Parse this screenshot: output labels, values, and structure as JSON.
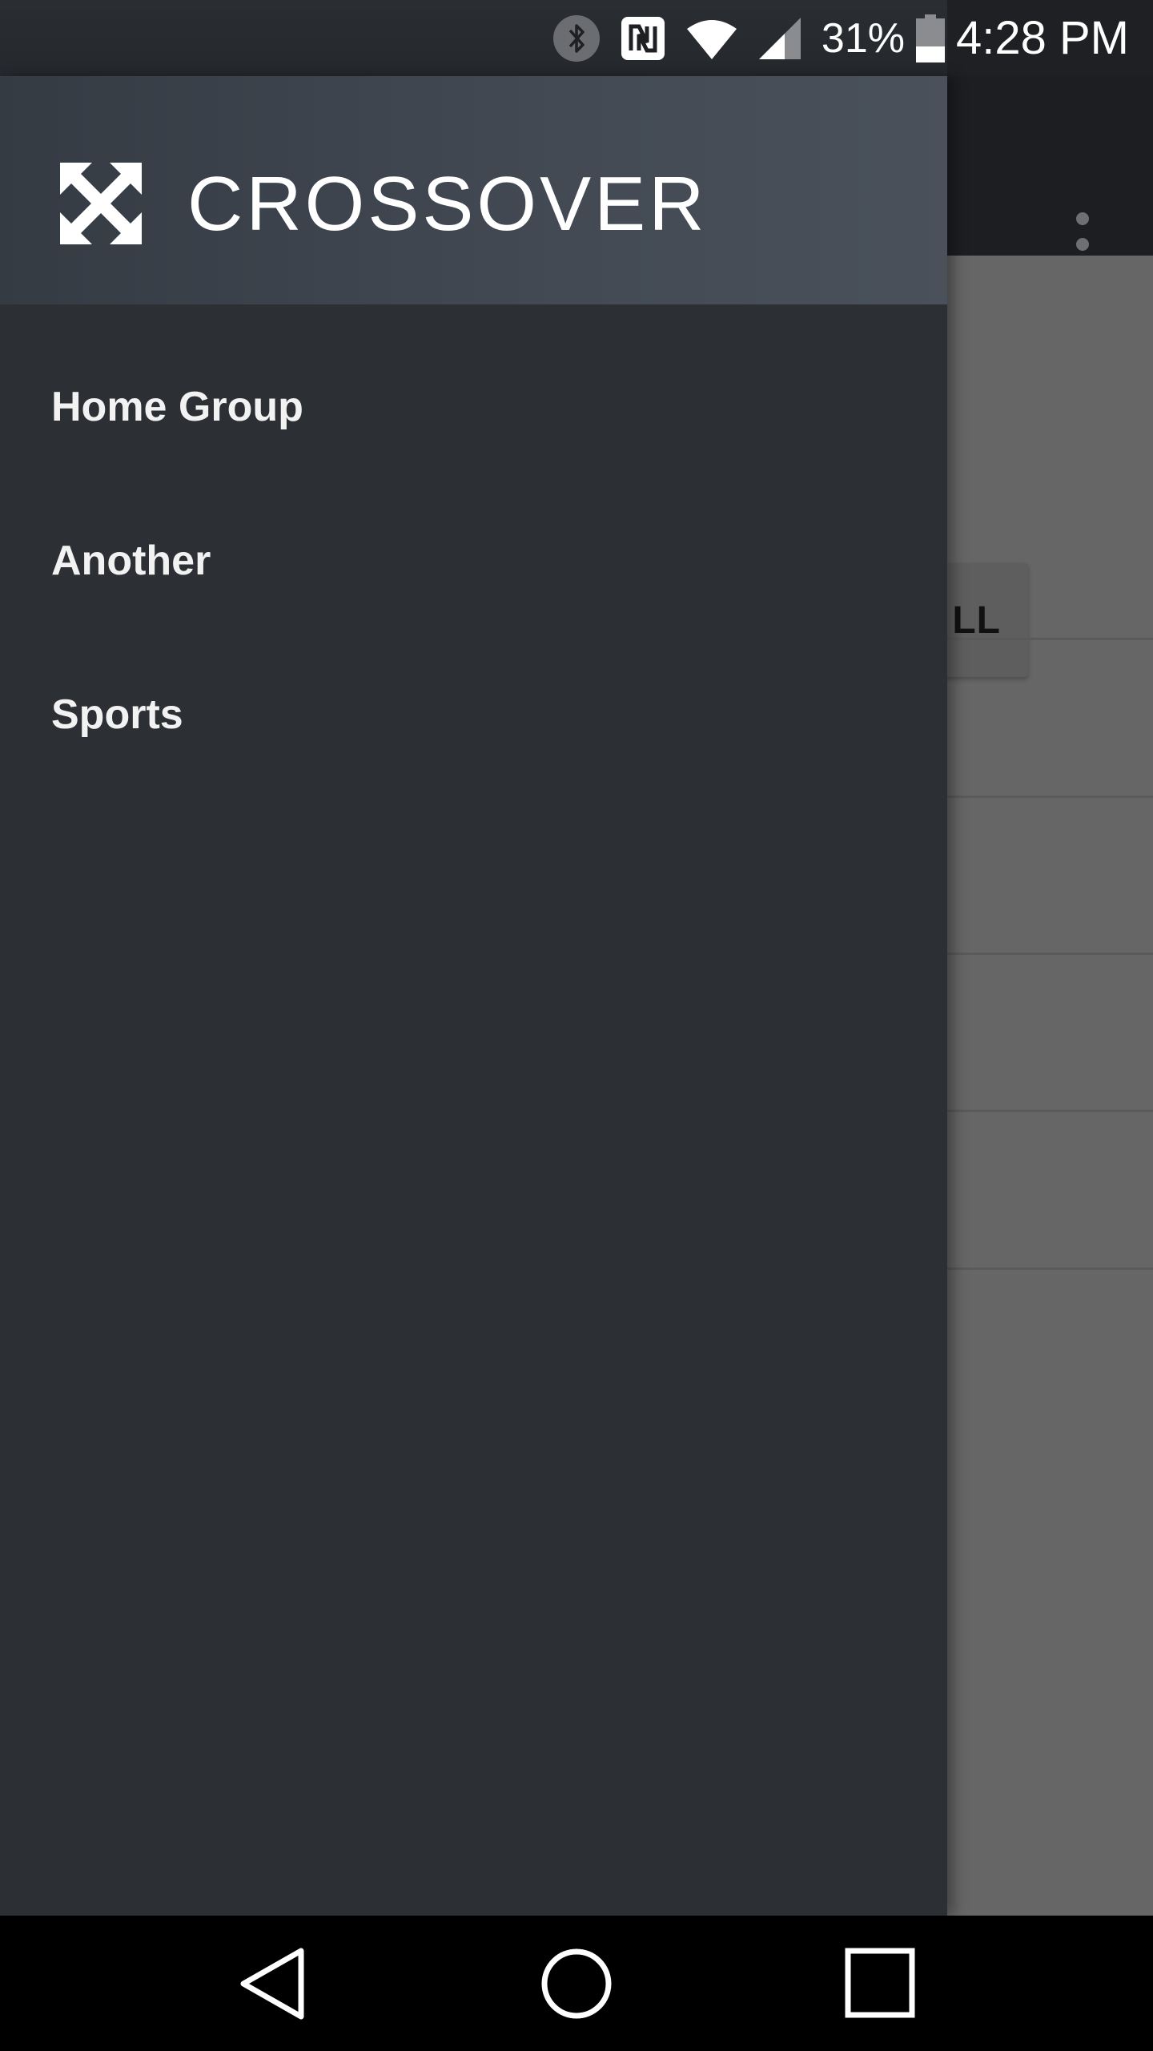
{
  "status_bar": {
    "battery_percent": "31%",
    "time": "4:28 PM",
    "icons": [
      "bluetooth-icon",
      "nfc-icon",
      "wifi-icon",
      "cell-signal-icon",
      "battery-icon"
    ]
  },
  "background_app": {
    "button_label_partial": "LL",
    "overflow_icon": "more-vert-icon"
  },
  "drawer": {
    "brand": "CROSSOVER",
    "logo_icon": "expand-arrows-icon",
    "items": [
      {
        "label": "Home Group"
      },
      {
        "label": "Another"
      },
      {
        "label": "Sports"
      }
    ]
  },
  "nav_bar": {
    "icons": [
      "back-icon",
      "home-icon",
      "recents-icon"
    ]
  },
  "colors": {
    "drawer_bg": "#2c3035",
    "header_bg": "#434a54",
    "scrim": "#666666",
    "text": "#ffffff"
  }
}
